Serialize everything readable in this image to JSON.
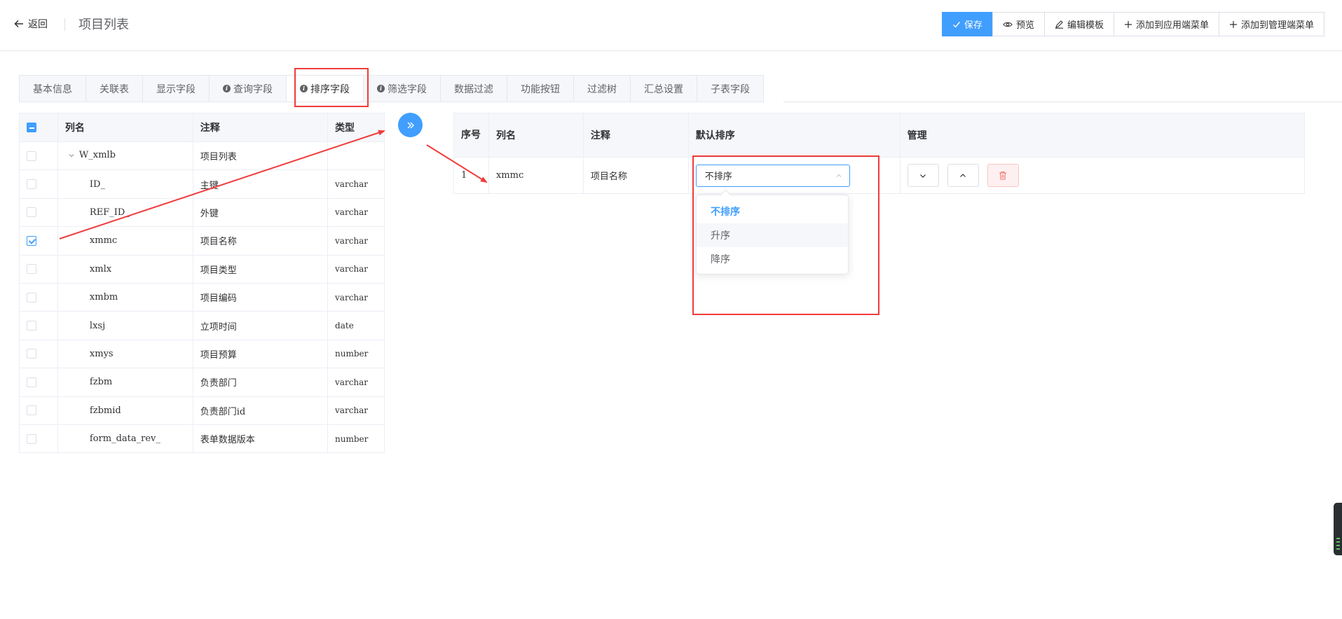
{
  "header": {
    "back_label": "返回",
    "title": "项目列表",
    "buttons": {
      "save": "保存",
      "preview": "预览",
      "edit_template": "编辑模板",
      "add_app_menu": "添加到应用端菜单",
      "add_admin_menu": "添加到管理端菜单"
    }
  },
  "tabs": [
    {
      "label": "基本信息",
      "info": false
    },
    {
      "label": "关联表",
      "info": false
    },
    {
      "label": "显示字段",
      "info": false
    },
    {
      "label": "查询字段",
      "info": true
    },
    {
      "label": "排序字段",
      "info": true,
      "active": true
    },
    {
      "label": "筛选字段",
      "info": true
    },
    {
      "label": "数据过滤",
      "info": false
    },
    {
      "label": "功能按钮",
      "info": false
    },
    {
      "label": "过滤树",
      "info": false
    },
    {
      "label": "汇总设置",
      "info": false
    },
    {
      "label": "子表字段",
      "info": false
    }
  ],
  "left_table": {
    "headers": {
      "column": "列名",
      "comment": "注释",
      "type": "类型"
    },
    "root": {
      "name": "W_xmlb",
      "comment": "项目列表"
    },
    "rows": [
      {
        "name": "ID_",
        "comment": "主键",
        "type": "varchar",
        "checked": false
      },
      {
        "name": "REF_ID_",
        "comment": "外键",
        "type": "varchar",
        "checked": false
      },
      {
        "name": "xmmc",
        "comment": "项目名称",
        "type": "varchar",
        "checked": true
      },
      {
        "name": "xmlx",
        "comment": "项目类型",
        "type": "varchar",
        "checked": false
      },
      {
        "name": "xmbm",
        "comment": "项目编码",
        "type": "varchar",
        "checked": false
      },
      {
        "name": "lxsj",
        "comment": "立项时间",
        "type": "date",
        "checked": false
      },
      {
        "name": "xmys",
        "comment": "项目预算",
        "type": "number",
        "checked": false
      },
      {
        "name": "fzbm",
        "comment": "负责部门",
        "type": "varchar",
        "checked": false
      },
      {
        "name": "fzbmid",
        "comment": "负责部门id",
        "type": "varchar",
        "checked": false
      },
      {
        "name": "form_data_rev_",
        "comment": "表单数据版本",
        "type": "number",
        "checked": false
      }
    ]
  },
  "right_table": {
    "headers": {
      "seq": "序号",
      "column": "列名",
      "comment": "注释",
      "default_sort": "默认排序",
      "manage": "管理"
    },
    "rows": [
      {
        "seq": "1",
        "name": "xmmc",
        "comment": "项目名称",
        "sort_value": "不排序"
      }
    ]
  },
  "sort_dropdown": {
    "options": [
      "不排序",
      "升序",
      "降序"
    ],
    "selected": "不排序",
    "hovered": "升序"
  },
  "colors": {
    "primary": "#409eff",
    "annotation": "#f03c3c",
    "danger_bg": "#fef0f0"
  }
}
